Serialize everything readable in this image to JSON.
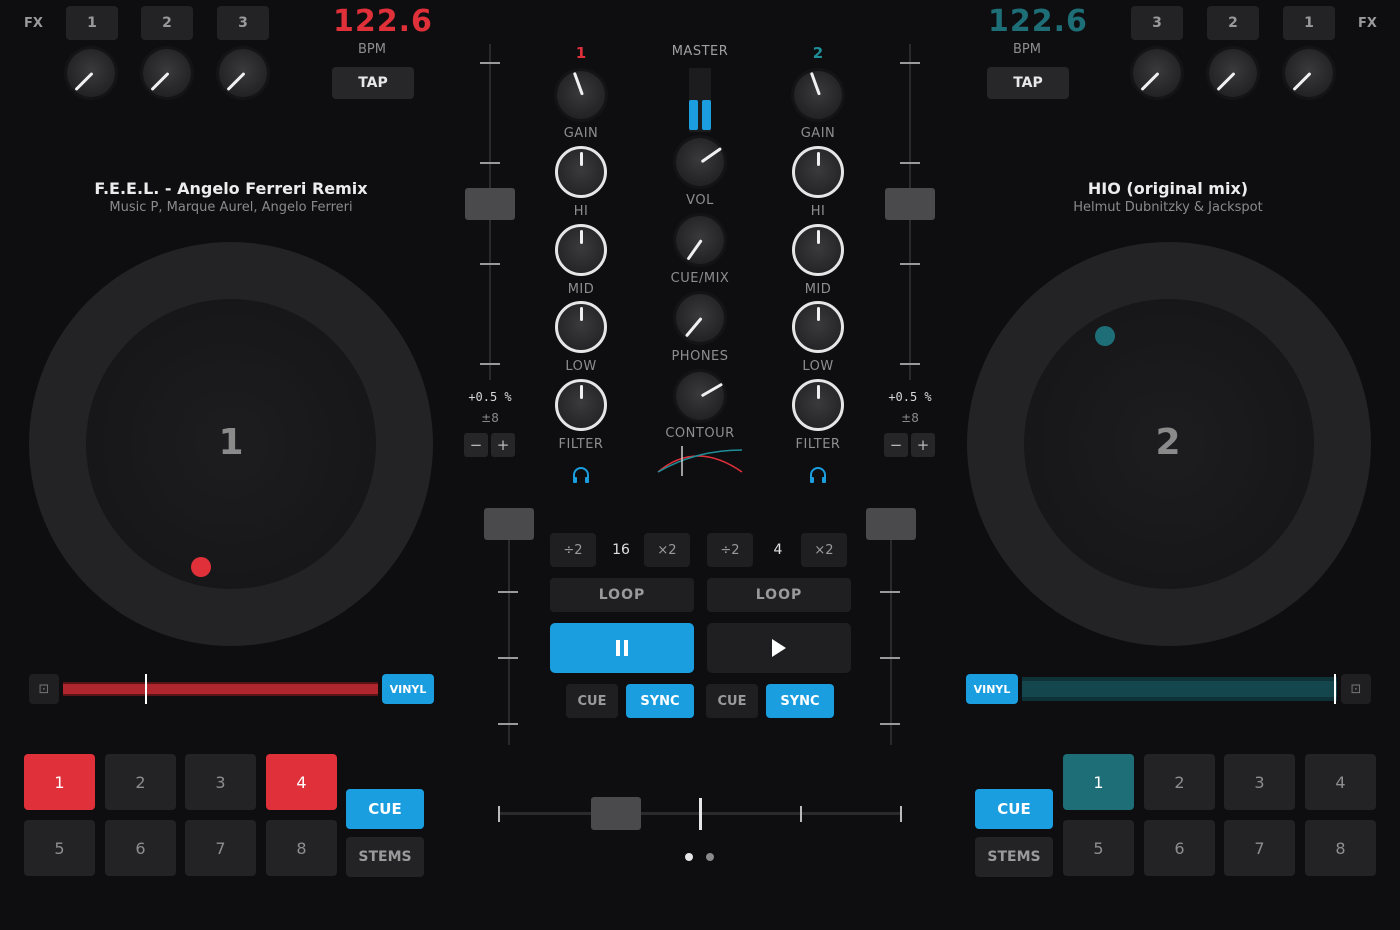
{
  "colors": {
    "deck1": "#e0303a",
    "deck2": "#1e6e78",
    "accent": "#1a9ee0"
  },
  "left": {
    "fx_label": "FX",
    "fx_buttons": [
      "1",
      "2",
      "3"
    ],
    "bpm": "122.6",
    "bpm_label": "BPM",
    "tap": "TAP",
    "title": "F.E.E.L. - Angelo Ferreri Remix",
    "artist": "Music P, Marque Aurel, Angelo Ferreri",
    "deck_number": "1",
    "vinyl": "VINYL",
    "pitch": "+0.5 %",
    "range": "±8",
    "minus": "−",
    "plus": "+",
    "pads": [
      "1",
      "2",
      "3",
      "4",
      "5",
      "6",
      "7",
      "8"
    ],
    "cue": "CUE",
    "stems": "STEMS",
    "loop": {
      "half": "÷2",
      "size": "16",
      "double": "×2",
      "label": "LOOP"
    },
    "cue_small": "CUE",
    "sync": "SYNC"
  },
  "right": {
    "fx_label": "FX",
    "fx_buttons": [
      "3",
      "2",
      "1"
    ],
    "bpm": "122.6",
    "bpm_label": "BPM",
    "tap": "TAP",
    "title": "HIO (original mix)",
    "artist": "Helmut Dubnitzky & Jackspot",
    "deck_number": "2",
    "vinyl": "VINYL",
    "pitch": "+0.5 %",
    "range": "±8",
    "minus": "−",
    "plus": "+",
    "pads": [
      "1",
      "2",
      "3",
      "4",
      "5",
      "6",
      "7",
      "8"
    ],
    "cue": "CUE",
    "stems": "STEMS",
    "loop": {
      "half": "÷2",
      "size": "4",
      "double": "×2",
      "label": "LOOP"
    },
    "cue_small": "CUE",
    "sync": "SYNC"
  },
  "mixer": {
    "ch1": "1",
    "ch2": "2",
    "master": "MASTER",
    "eq_labels": [
      "GAIN",
      "HI",
      "MID",
      "LOW",
      "FILTER"
    ],
    "center_labels": [
      "VOL",
      "CUE/MIX",
      "PHONES",
      "CONTOUR"
    ]
  },
  "icons": {
    "headphones": "headphones-icon",
    "lock": "lock-icon",
    "pause": "pause-icon",
    "play": "play-icon"
  }
}
